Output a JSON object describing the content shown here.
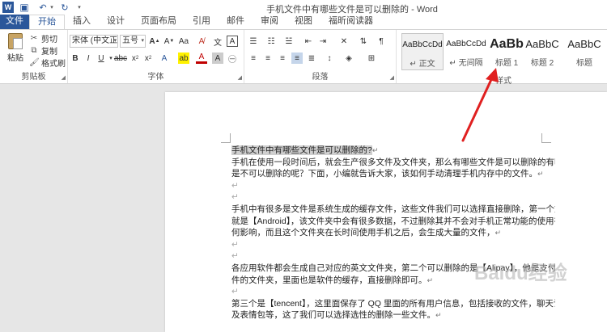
{
  "window": {
    "title": "手机文件中有哪些文件是可以删除的 - Word"
  },
  "tabs": [
    {
      "label": "文件"
    },
    {
      "label": "开始"
    },
    {
      "label": "插入"
    },
    {
      "label": "设计"
    },
    {
      "label": "页面布局"
    },
    {
      "label": "引用"
    },
    {
      "label": "邮件"
    },
    {
      "label": "审阅"
    },
    {
      "label": "视图"
    },
    {
      "label": "福昕阅读器"
    }
  ],
  "clipboard": {
    "paste": "粘贴",
    "cut": "剪切",
    "copy": "复制",
    "format_painter": "格式刷",
    "group_label": "剪贴板"
  },
  "font": {
    "font_name": "宋体 (中文正",
    "font_size": "五号",
    "group_label": "字体"
  },
  "paragraph": {
    "group_label": "段落"
  },
  "styles": {
    "items": [
      {
        "sample": "AaBbCcDd",
        "name": "↵ 正文"
      },
      {
        "sample": "AaBbCcDd",
        "name": "↵ 无间隔"
      },
      {
        "sample": "AaBb",
        "name": "标题 1"
      },
      {
        "sample": "AaBbC",
        "name": "标题 2"
      },
      {
        "sample": "AaBbC",
        "name": "标题"
      }
    ],
    "group_label": "样式"
  },
  "document": {
    "heading": "手机文件中有哪些文件是可以删除的?",
    "lines": [
      "手机在使用一段时间后，就会生产很多文件及文件夹，那么有哪些文件是可以删除的有哪些",
      "是不可以删除的呢？下面，小编就告诉大家，该如何手动清理手机内存中的文件。",
      "",
      "",
      "手机中有很多是文件是系统生成的缓存文件，这些文件我们可以选择直接删除，第一个文件",
      "就是【Android】，该文件夹中会有很多数据，不过删除其并不会对手机正常功能的使用有任",
      "何影响，而且这个文件夹在长时间使用手机之后，会生成大量的文件，",
      "",
      "",
      "各应用软件都会生成自己对应的英文文件夹，第二个可以删除的是【Alipay】，他是支付软",
      "件的文件夹，里面也是软件的缓存，直接删除即可。",
      "",
      "第三个是【tencent】，这里面保存了 QQ 里面的所有用户信息，包括接收的文件，聊天记录",
      "及表情包等，这了我们可以选择选性的删除一些文件。"
    ]
  },
  "watermark": "Baidu经验",
  "colors": {
    "accent": "#2b579a",
    "arrow": "#e02020"
  }
}
